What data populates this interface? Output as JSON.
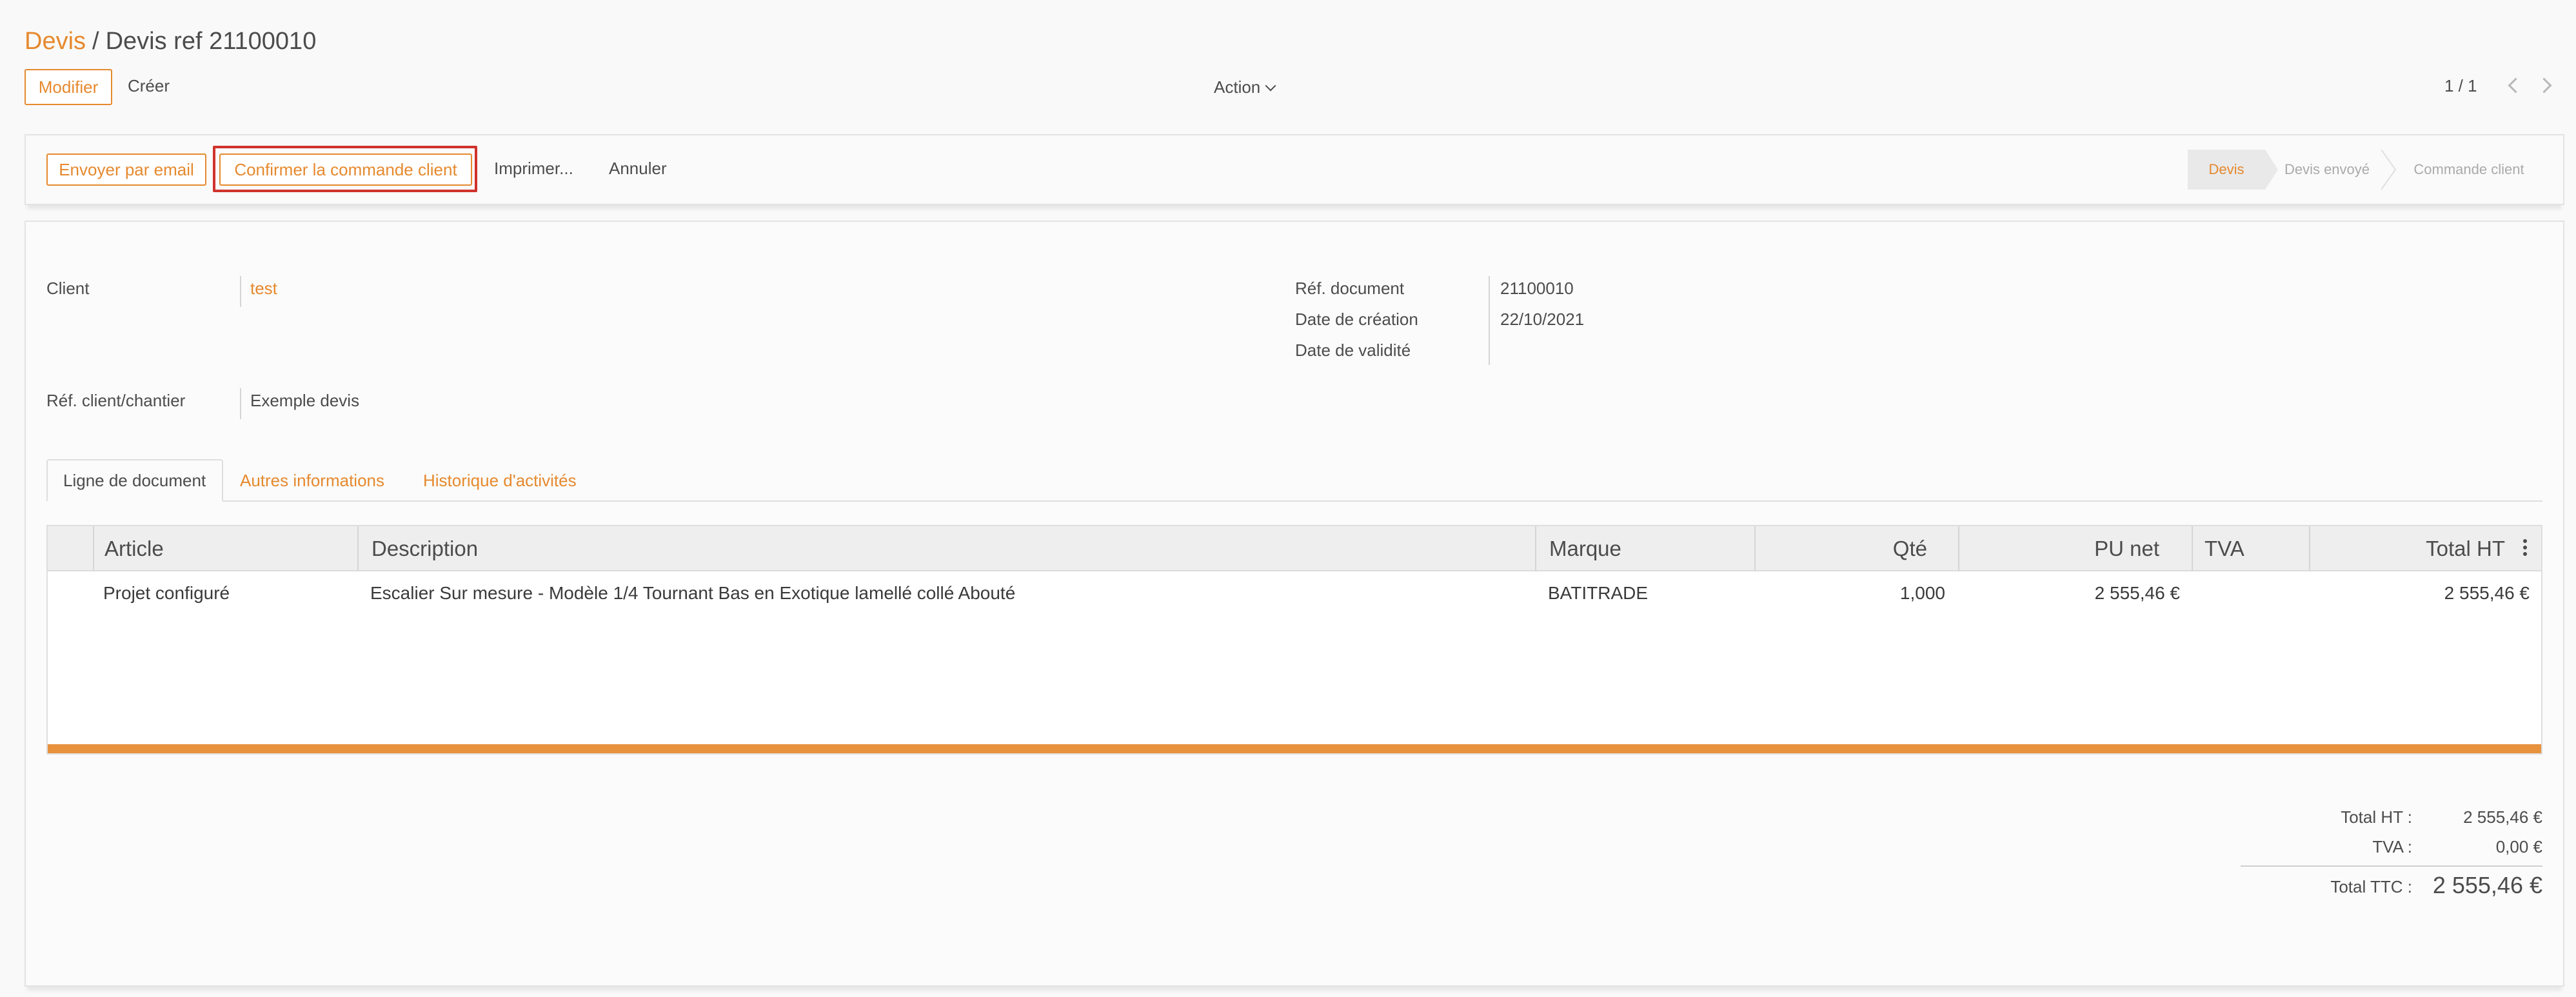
{
  "breadcrumb": {
    "parent": "Devis",
    "separator": "/",
    "current": "Devis ref 21100010"
  },
  "control": {
    "edit_label": "Modifier",
    "create_label": "Créer",
    "action_label": "Action",
    "pager": "1 / 1"
  },
  "statusbar": {
    "buttons": {
      "email": "Envoyer par email",
      "confirm": "Confirmer la commande client",
      "print": "Imprimer...",
      "cancel": "Annuler"
    },
    "stages": [
      "Devis",
      "Devis envoyé",
      "Commande client"
    ],
    "active_stage": "Devis"
  },
  "form": {
    "client_label": "Client",
    "client_value": "test",
    "ref_client_label": "Réf. client/chantier",
    "ref_client_value": "Exemple devis",
    "ref_doc_label": "Réf. document",
    "ref_doc_value": "21100010",
    "date_creation_label": "Date de création",
    "date_creation_value": "22/10/2021",
    "date_validite_label": "Date de validité",
    "date_validite_value": ""
  },
  "tabs": [
    "Ligne de document",
    "Autres informations",
    "Historique d'activités"
  ],
  "table": {
    "headers": [
      "Article",
      "Description",
      "Marque",
      "Qté",
      "PU net",
      "TVA",
      "Total HT"
    ],
    "rows": [
      {
        "article": "Projet configuré",
        "description": "Escalier Sur mesure - Modèle 1/4 Tournant Bas en Exotique lamellé collé Abouté",
        "marque": "BATITRADE",
        "qte": "1,000",
        "pu_net": "2 555,46 €",
        "tva": "",
        "total_ht": "2 555,46 €"
      }
    ]
  },
  "totals": {
    "ht_label": "Total HT :",
    "ht_value": "2 555,46 €",
    "tva_label": "TVA :",
    "tva_value": "0,00 €",
    "ttc_label": "Total TTC :",
    "ttc_value": "2 555,46 €"
  },
  "colors": {
    "accent": "#e6892e",
    "highlight": "#d0332c",
    "bar": "#e8923e"
  }
}
